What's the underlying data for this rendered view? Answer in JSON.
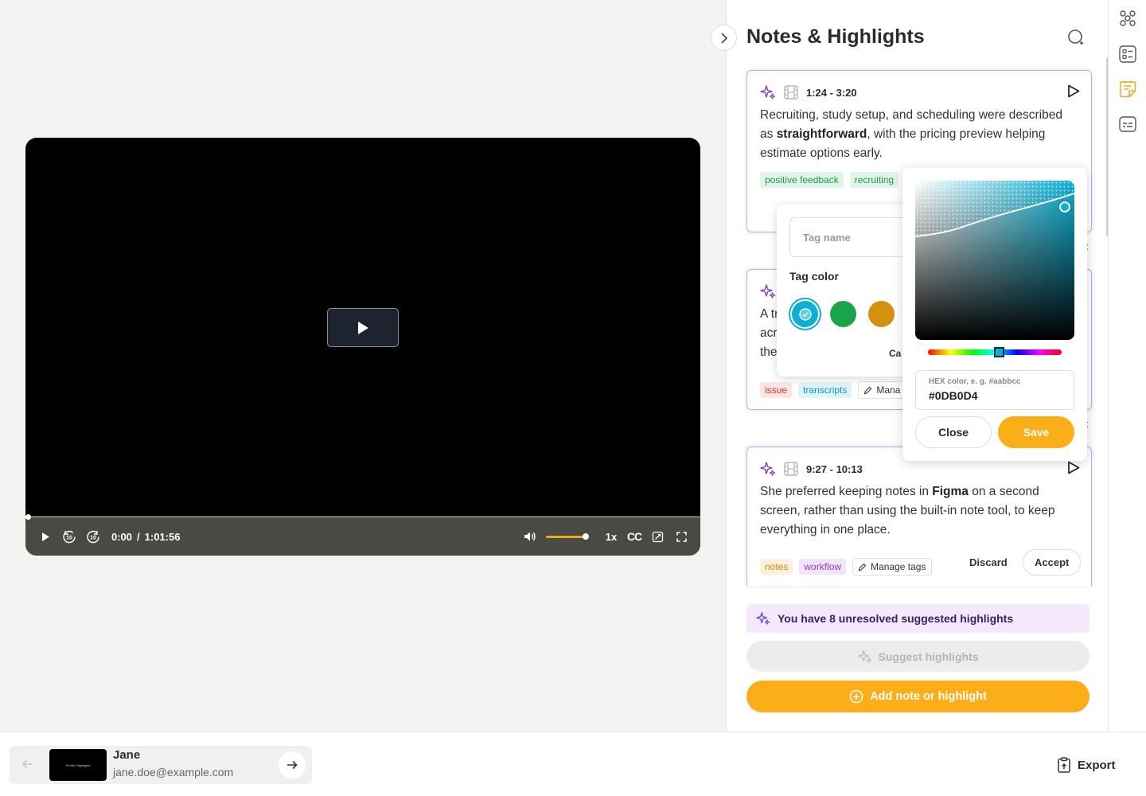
{
  "panel": {
    "title": "Notes & Highlights"
  },
  "cards": [
    {
      "time": "1:24 - 3:20",
      "text_parts": [
        "Recruiting, study setup, and scheduling were described as ",
        "straightforward",
        ", with the pricing preview helping estimate options early."
      ],
      "tags": [
        "positive feedback",
        "recruiting"
      ]
    },
    {
      "text_fragments": [
        "A tr",
        "acro",
        "the"
      ],
      "tags": [
        "issue",
        "transcripts"
      ],
      "manage_label": "Mana"
    },
    {
      "time": "9:27 - 10:13",
      "text_parts": [
        "She preferred keeping notes in ",
        "Figma",
        " on a second screen, rather than using the built-in note tool, to keep everything in one place."
      ],
      "tags": [
        "notes",
        "workflow"
      ],
      "manage_label": "Manage tags",
      "discard_label": "Discard",
      "accept_label": "Accept"
    }
  ],
  "peek_letters": [
    "t",
    "t"
  ],
  "unresolved_text": "You have 8 unresolved suggested highlights",
  "suggest_label": "Suggest highlights",
  "add_note_label": "Add note or highlight",
  "video": {
    "current_time": "0:00",
    "separator": "/",
    "duration": "1:01:56",
    "speed": "1x",
    "cc_label": "CC",
    "volume": 1.0,
    "progress": 0.0
  },
  "tag_popover": {
    "tag_name_placeholder": "Tag name",
    "tag_color_label": "Tag color",
    "swatches": [
      "#0DB0D4",
      "#1aa34a",
      "#d4900f"
    ],
    "cancel_fragment": "Ca"
  },
  "color_picker": {
    "hex_label": "HEX color, e. g. #aabbcc",
    "hex_value": "#0DB0D4",
    "close_label": "Close",
    "save_label": "Save"
  },
  "participant": {
    "name": "Jane",
    "email": "jane.doe@example.com",
    "thumb_text": "Prolific Highlights"
  },
  "export_label": "Export",
  "colors": {
    "accent": "#fbae17",
    "purple": "#7b3fc4"
  }
}
